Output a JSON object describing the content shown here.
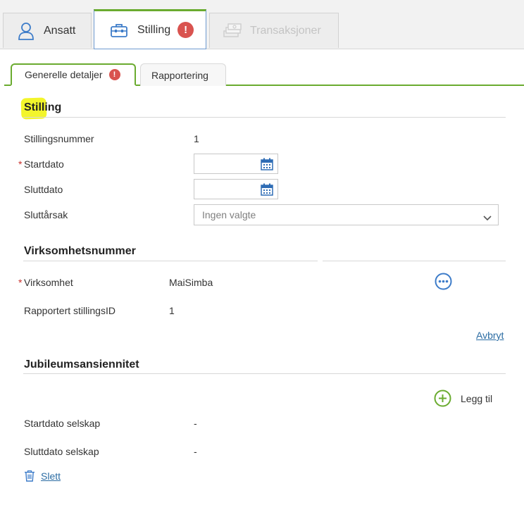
{
  "top_tabs": [
    {
      "label": "Ansatt",
      "icon": "person-icon"
    },
    {
      "label": "Stilling",
      "icon": "briefcase-icon",
      "alert": "!"
    },
    {
      "label": "Transaksjoner",
      "icon": "money-stack-icon"
    }
  ],
  "sub_tabs": [
    {
      "label": "Generelle detaljer",
      "alert": "!"
    },
    {
      "label": "Rapportering"
    }
  ],
  "stilling": {
    "title": "Stilling",
    "stillingsnummer_label": "Stillingsnummer",
    "stillingsnummer_value": "1",
    "required_marker": "*",
    "startdato_label": "Startdato",
    "startdato_value": "",
    "sluttdato_label": "Sluttdato",
    "sluttdato_value": "",
    "sluttarsak_label": "Sluttårsak",
    "sluttarsak_value": "Ingen valgte"
  },
  "virksomhetsnummer": {
    "title": "Virksomhetsnummer",
    "virksomhet_label": "Virksomhet",
    "virksomhet_value": "MaiSimba",
    "rapportert_label": "Rapportert stillingsID",
    "rapportert_value": "1",
    "avbryt_label": "Avbryt"
  },
  "jubileum": {
    "title": "Jubileumsansiennitet",
    "add_label": "Legg til",
    "startdato_label": "Startdato selskap",
    "startdato_value": "-",
    "sluttdato_label": "Sluttdato selskap",
    "sluttdato_value": "-",
    "delete_label": "Slett"
  },
  "colors": {
    "accent_green": "#6aab2f",
    "link_blue": "#2b6ca3",
    "alert_red": "#d9534f",
    "highlight_yellow": "#f3f52b"
  }
}
